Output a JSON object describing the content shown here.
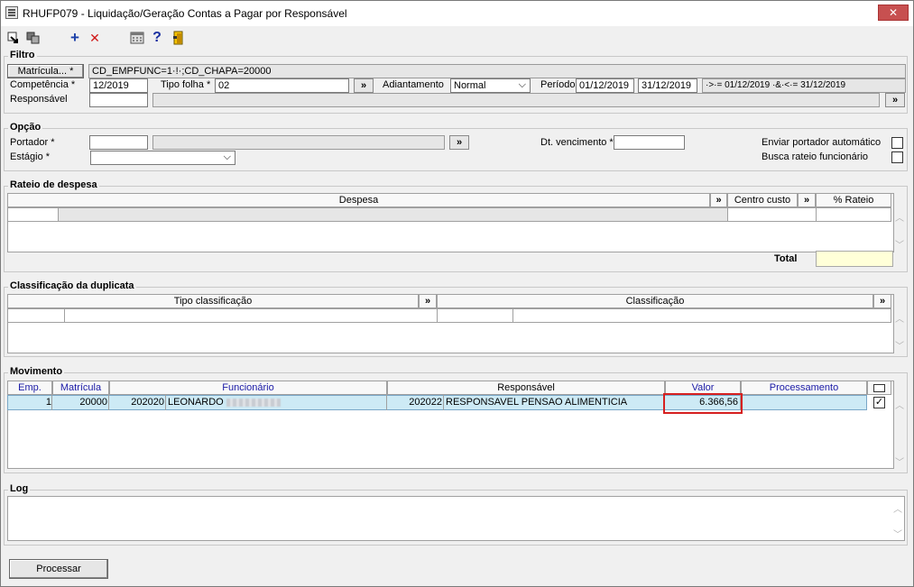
{
  "window": {
    "title": "RHUFP079 - Liquidação/Geração Contas a Pagar por Responsável",
    "close": "✕"
  },
  "toolbar": {
    "icons": [
      "import-icon",
      "copy-icon",
      "add-icon",
      "delete-icon",
      "calculator-icon",
      "help-icon",
      "exit-icon"
    ],
    "add_glyph": "+",
    "delete_glyph": "✕",
    "help_glyph": "?"
  },
  "filtro": {
    "legend": "Filtro",
    "matricula_button": "Matrícula... *",
    "matricula_value": "CD_EMPFUNC=1·!·;CD_CHAPA=20000",
    "competencia_label": "Competência *",
    "competencia_value": "12/2019",
    "tipo_folha_label": "Tipo folha *",
    "tipo_folha_value": "02",
    "tipo_folha_lookup": "»",
    "adiantamento_label": "Adiantamento",
    "adiantamento_value": "Normal",
    "periodo_label": "Período",
    "periodo_start": "01/12/2019",
    "periodo_end": "31/12/2019",
    "periodo_expression": "·>·= 01/12/2019 ·&·<·= 31/12/2019",
    "responsavel_label": "Responsável",
    "responsavel_value": "",
    "responsavel_lookup": "»"
  },
  "opcao": {
    "legend": "Opção",
    "portador_label": "Portador *",
    "portador_lookup": "»",
    "estagio_label": "Estágio *",
    "dt_vencimento_label": "Dt. vencimento *",
    "enviar_portador_label": "Enviar portador automático",
    "busca_rateio_label": "Busca rateio funcionário"
  },
  "rateio": {
    "legend": "Rateio de despesa",
    "col_despesa": "Despesa",
    "col_centro_custo": "Centro custo",
    "col_rateio": "% Rateio",
    "lookup": "»",
    "total_label": "Total"
  },
  "classificacao": {
    "legend": "Classificação da duplicata",
    "col_tipo": "Tipo classificação",
    "col_classificacao": "Classificação",
    "lookup": "»"
  },
  "movimento": {
    "legend": "Movimento",
    "columns": {
      "emp": "Emp.",
      "matricula": "Matrícula",
      "funcionario": "Funcionário",
      "responsavel": "Responsável",
      "valor": "Valor",
      "processamento": "Processamento"
    },
    "rows": [
      {
        "emp": "1",
        "matricula": "20000",
        "func_code": "202020",
        "func_name": "LEONARDO",
        "resp_code": "202022",
        "resp_name": "RESPONSAVEL PENSAO ALIMENTICIA",
        "valor": "6.366,56",
        "checked": "✓"
      }
    ]
  },
  "log": {
    "legend": "Log"
  },
  "actions": {
    "processar": "Processar"
  },
  "scroll": {
    "up": "︿",
    "down": "﹀"
  },
  "colors": {
    "selected_row": "#cdeaf5",
    "highlight_box": "#d62020",
    "header_blue": "#1a1aa6",
    "total_field": "#ffffd8"
  }
}
